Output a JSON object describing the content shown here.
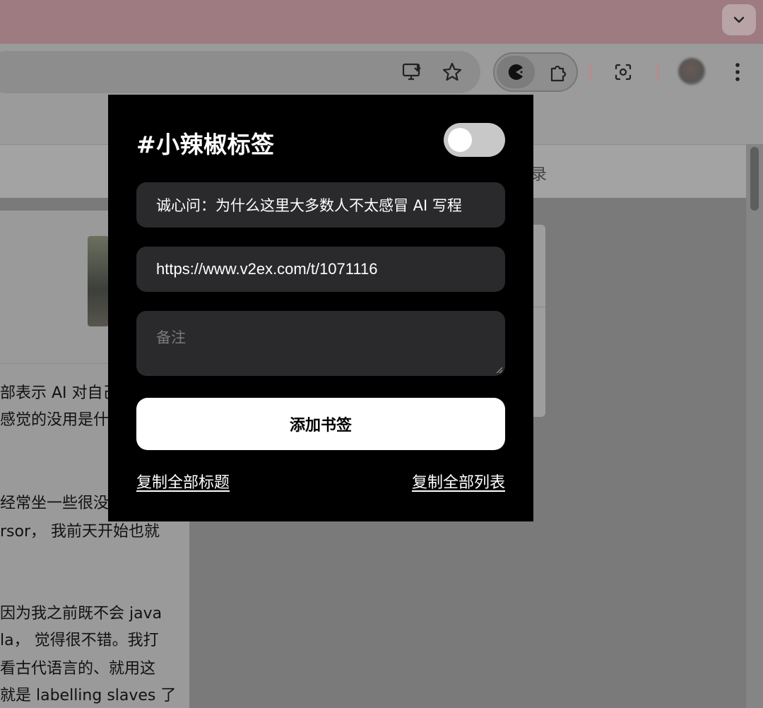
{
  "browser": {
    "toolbar_icons": [
      "install-app-icon",
      "bookmark-star-icon",
      "extension-pacman-icon",
      "extensions-puzzle-icon",
      "google-lens-icon",
      "profile-avatar",
      "more-menu-icon"
    ]
  },
  "page": {
    "nav_fragment": "录",
    "body_lines": [
      "部表示 AI 对自己",
      "感觉的没用是什",
      "经常坐一些很没",
      "rsor， 我前天开始也就",
      "因为我之前既不会 java",
      "la， 觉得很不错。我打",
      "看古代语言的、就用这",
      "就是 labelling slaves 了"
    ]
  },
  "popup": {
    "title": "#小辣椒标签",
    "toggle_on": false,
    "title_field_value": "诚心问：为什么这里大多数人不太感冒 AI 写程",
    "url_field_value": "https://www.v2ex.com/t/1071116",
    "note_placeholder": "备注",
    "add_button_label": "添加书签",
    "copy_titles_link": "复制全部标题",
    "copy_list_link": "复制全部列表"
  },
  "colors": {
    "popup_bg": "#000000",
    "field_bg": "#2a2a2c",
    "button_bg": "#ffffff",
    "toggle_off": "#c8c8c8"
  }
}
